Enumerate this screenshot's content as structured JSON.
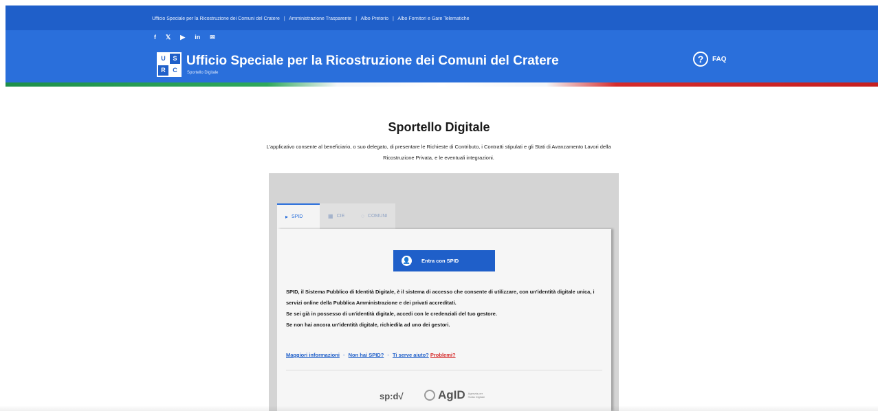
{
  "header": {
    "top_links": [
      "Ufficio Speciale per la Ricostruzione dei Comuni del Cratere",
      "|",
      "Amministrazione Trasparente",
      "|",
      "Albo Pretorio",
      "|",
      "Albo Fornitori e Gare Telematiche"
    ],
    "socials": [
      {
        "icon": "facebook-icon",
        "glyph": "f"
      },
      {
        "icon": "x-icon",
        "glyph": "𝕏"
      },
      {
        "icon": "youtube-icon",
        "glyph": "▶"
      },
      {
        "icon": "linkedin-icon",
        "glyph": "in"
      },
      {
        "icon": "email-icon",
        "glyph": "✉"
      }
    ],
    "logo_letters": [
      "U",
      "S",
      "R",
      "C"
    ],
    "brand_title": "Ufficio Speciale per la Ricostruzione dei Comuni del Cratere",
    "brand_subtitle": "Sportello Digitale",
    "faq_icon": "?",
    "faq_label": "FAQ",
    "colors": {
      "primary": "#2a6fdb",
      "slim": "#1f5fc9",
      "green": "#1e8f4a",
      "red": "#d52b2b"
    }
  },
  "main": {
    "title": "Sportello Digitale",
    "intro": "L'applicativo consente al beneficiario, o suo delegato, di presentare le Richieste di Contributo, i Contratti stipulati e gli Stati di Avanzamento Lavori della Ricostruzione Privata, e le eventuali integrazioni.",
    "tabs": [
      {
        "label": "SPID",
        "icon": "spid-tab-icon",
        "glyph": "▸"
      },
      {
        "label": "CIE",
        "icon": "cie-card-icon",
        "glyph": "▦"
      },
      {
        "label": "COMUNI",
        "icon": "comuni-icon",
        "glyph": "◌"
      }
    ],
    "spid_button_icon": "👤",
    "spid_button": "Entra con SPID",
    "description": [
      "SPID, il Sistema Pubblico di Identità Digitale, è il sistema di accesso che consente di utilizzare, con un'identità digitale unica, i servizi online della Pubblica Amministrazione e dei privati accreditati.",
      "Se sei già in possesso di un'identità digitale, accedi con le credenziali del tuo gestore.",
      "Se non hai ancora un'identità digitale, richiedila ad uno dei gestori."
    ],
    "links": {
      "more_info": "Maggiori informazioni",
      "no_spid": "Non hai SPID?",
      "help": "Ti serve aiuto?",
      "problems": "Problemi?",
      "separator": "-"
    },
    "footer_logos": {
      "spid": "sp:d√",
      "agid": "AgID",
      "agid_small": "Agenzia per l'Italia Digitale"
    }
  }
}
